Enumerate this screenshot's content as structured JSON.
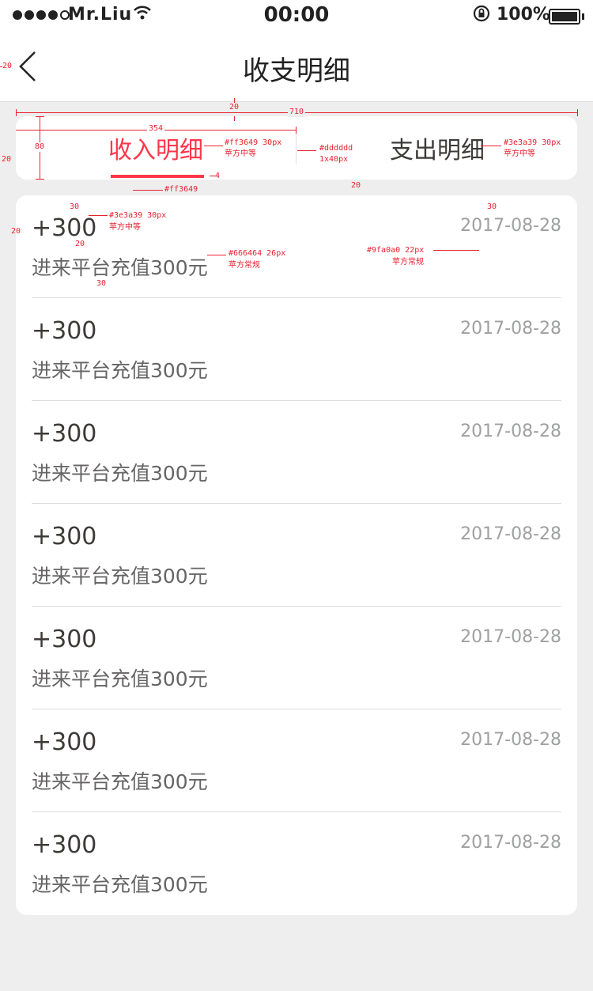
{
  "status_bar": {
    "carrier": "Mr.Liu",
    "time": "00:00",
    "battery": "100%"
  },
  "nav": {
    "title": "收支明细"
  },
  "tabs": [
    {
      "label": "收入明细",
      "active": true
    },
    {
      "label": "支出明细",
      "active": false
    }
  ],
  "records": [
    {
      "amount": "+300",
      "desc": "进来平台充值300元",
      "date": "2017-08-28"
    },
    {
      "amount": "+300",
      "desc": "进来平台充值300元",
      "date": "2017-08-28"
    },
    {
      "amount": "+300",
      "desc": "进来平台充值300元",
      "date": "2017-08-28"
    },
    {
      "amount": "+300",
      "desc": "进来平台充值300元",
      "date": "2017-08-28"
    },
    {
      "amount": "+300",
      "desc": "进来平台充值300元",
      "date": "2017-08-28"
    },
    {
      "amount": "+300",
      "desc": "进来平台充值300元",
      "date": "2017-08-28"
    },
    {
      "amount": "+300",
      "desc": "进来平台充值300元",
      "date": "2017-08-28"
    }
  ],
  "colors": {
    "accent": "#ff3649",
    "primary_text": "#3e3a39",
    "secondary_text": "#666464",
    "muted_text": "#9fa0a0",
    "divider": "#dddddd",
    "background": "#eeeeee"
  },
  "annotations": {
    "margin_20": "20",
    "total_width": "710",
    "tab_width": "354",
    "tab_height": "80",
    "indicator_h": "4",
    "gap_20": "20",
    "pad_30": "30",
    "gap_row": "20",
    "pad_bottom": "30",
    "pad_right": "30",
    "tab_active_spec": "#ff3649   30px",
    "tab_active_font": "苹方中等",
    "divider_spec": "#dddddd",
    "divider_size": "1x40px",
    "tab_inactive_spec": "#3e3a39   30px",
    "tab_inactive_font": "苹方中等",
    "indicator_color": "#ff3649",
    "amount_spec": "#3e3a39   30px",
    "amount_font": "苹方中等",
    "desc_spec": "#666464   26px",
    "desc_font": "苹方常规",
    "date_spec": "#9fa0a0   22px",
    "date_font": "苹方常规"
  }
}
